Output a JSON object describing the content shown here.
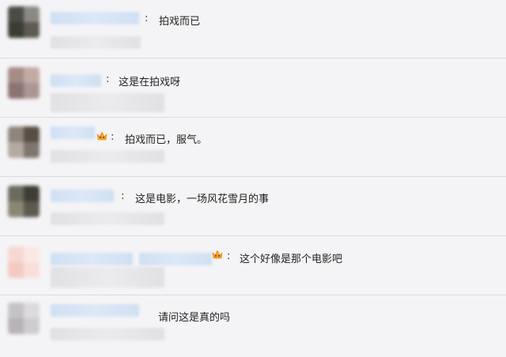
{
  "comments": [
    {
      "text": "拍戏而已",
      "colon": ":"
    },
    {
      "text": "这是在拍戏呀",
      "colon": ":"
    },
    {
      "text": "拍戏而已，服气。",
      "colon": ":"
    },
    {
      "text": "这是电影，一场风花雪月的事",
      "colon": ":"
    },
    {
      "text": "这个好像是那个电影吧",
      "colon": ":"
    },
    {
      "text": "请问这是真的吗",
      "colon": ""
    }
  ],
  "icons": {
    "vip": "crown-icon"
  },
  "colors": {
    "name_blur": "#cfe0f3",
    "divider": "#dcdcdf",
    "background": "#f4f4f6"
  }
}
